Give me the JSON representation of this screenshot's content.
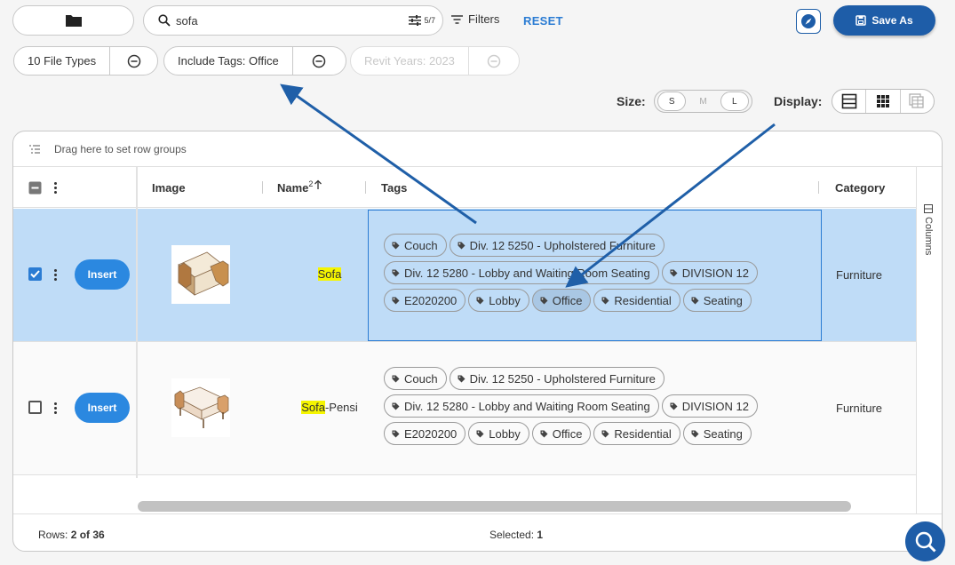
{
  "search": {
    "value": "sofa",
    "match_count": "5/7"
  },
  "toolbar": {
    "filters_label": "Filters",
    "reset_label": "RESET",
    "save_as_label": "Save As"
  },
  "chips": [
    {
      "label": "10 File Types",
      "enabled": true
    },
    {
      "label": "Include Tags: Office",
      "enabled": true
    },
    {
      "label": "Revit Years: 2023",
      "enabled": false
    }
  ],
  "size": {
    "label": "Size:",
    "options": [
      "S",
      "M",
      "L"
    ],
    "disabled": "M"
  },
  "display": {
    "label": "Display:",
    "options": [
      "list-icon",
      "grid-icon",
      "gallery-icon"
    ]
  },
  "grid": {
    "row_groups_hint": "Drag here to set row groups",
    "columns": {
      "image": "Image",
      "name": "Name",
      "name_sort_index": "2",
      "tags": "Tags",
      "category": "Category"
    },
    "side_panel_label": "Columns",
    "rows": [
      {
        "selected": true,
        "insert_label": "Insert",
        "name_highlight": "Sofa",
        "name_rest": "",
        "category": "Furniture",
        "tags": [
          "Couch",
          "Div. 12 5250 - Upholstered Furniture",
          "Div. 12 5280 - Lobby and Waiting Room Seating",
          "DIVISION 12",
          "E2020200",
          "Lobby",
          "Office",
          "Residential",
          "Seating"
        ],
        "active_tag": "Office"
      },
      {
        "selected": false,
        "insert_label": "Insert",
        "name_highlight": "Sofa",
        "name_rest": "-Pensi",
        "category": "Furniture",
        "tags": [
          "Couch",
          "Div. 12 5250 - Upholstered Furniture",
          "Div. 12 5280 - Lobby and Waiting Room Seating",
          "DIVISION 12",
          "E2020200",
          "Lobby",
          "Office",
          "Residential",
          "Seating"
        ],
        "active_tag": ""
      }
    ]
  },
  "footer": {
    "rows_label": "Rows:",
    "rows_value": "2 of 36",
    "selected_label": "Selected:",
    "selected_value": "1"
  },
  "colors": {
    "accent": "#1e5da8",
    "selection": "#bfdcf7",
    "highlight": "#f5f500",
    "annotation_arrow": "#1f5fa8"
  }
}
